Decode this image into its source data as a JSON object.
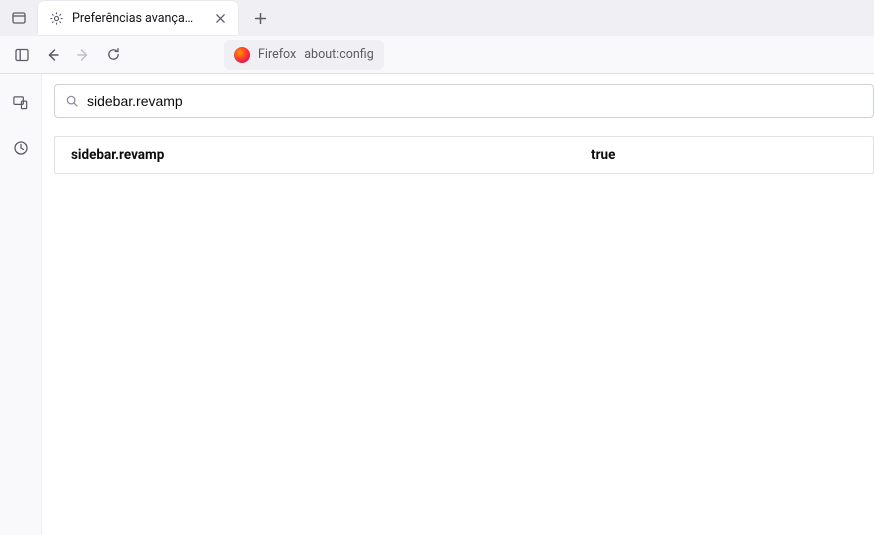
{
  "tab": {
    "label": "Preferências avançadas"
  },
  "url": {
    "identity_label": "Firefox",
    "address": "about:config"
  },
  "search": {
    "value": "sidebar.revamp"
  },
  "prefs": [
    {
      "name": "sidebar.revamp",
      "value": "true"
    }
  ]
}
